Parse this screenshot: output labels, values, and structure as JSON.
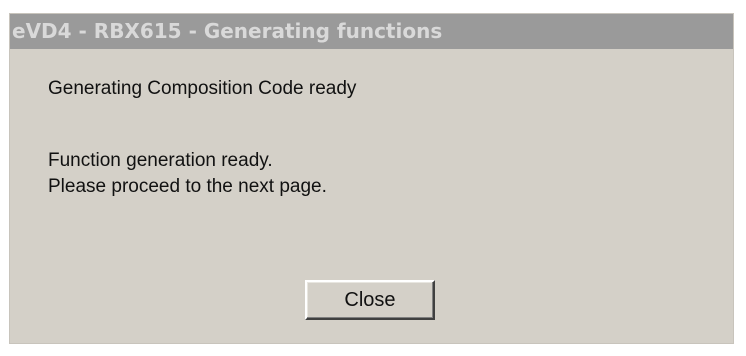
{
  "dialog": {
    "title": "eVD4 - RBX615 - Generating functions",
    "message_line1": "Generating Composition Code ready",
    "message_line2": "Function generation ready.",
    "message_line3": "Please proceed to the next page.",
    "close_label": "Close"
  },
  "colors": {
    "titlebar_bg": "#9a9a9a",
    "titlebar_text": "#d9d9d9",
    "window_bg": "#d4d0c8"
  }
}
